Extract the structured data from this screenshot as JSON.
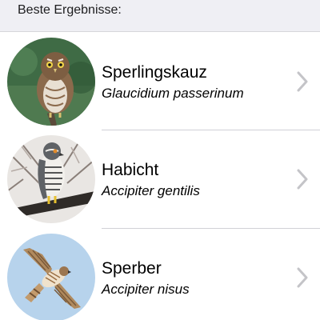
{
  "section": {
    "title": "Beste Ergebnisse:"
  },
  "results": [
    {
      "name": "Sperlingskauz",
      "latin": "Glaucidium passerinum",
      "image": "pygmy-owl-photo"
    },
    {
      "name": "Habicht",
      "latin": "Accipiter gentilis",
      "image": "goshawk-photo"
    },
    {
      "name": "Sperber",
      "latin": "Accipiter nisus",
      "image": "sparrowhawk-photo"
    }
  ],
  "colors": {
    "header_background": "#efeff4",
    "separator": "#d1d1d6",
    "chevron": "#c4c4c8"
  }
}
